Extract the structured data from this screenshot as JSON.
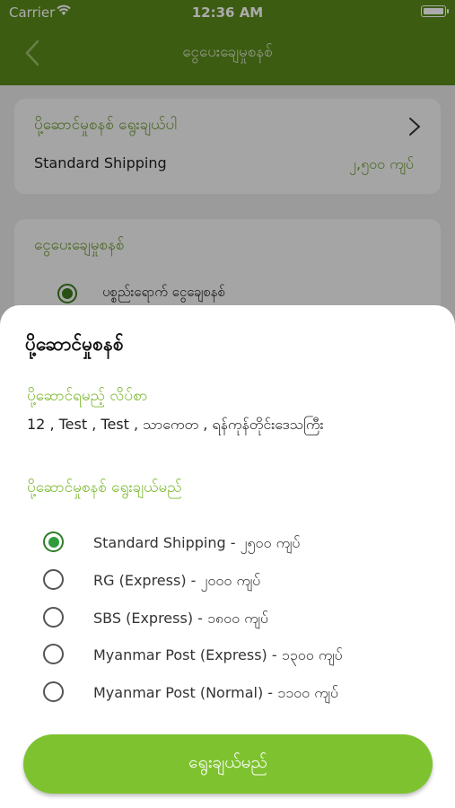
{
  "status_bar": {
    "carrier": "Carrier",
    "time": "12:36 AM"
  },
  "nav": {
    "title": "ငွေပေးချေမှုစနစ်"
  },
  "background": {
    "shipping_card": {
      "title": "ပို့ဆောင်မှုစနစ် ရွေးချယ်ပါ",
      "selected_name": "Standard Shipping",
      "selected_price": "၂,၅၀၀ ကျပ်"
    },
    "payment_card": {
      "title": "ငွေပေးချေမှုစနစ်",
      "option": "ပစ္စည်းရောက် ငွေချေစနစ်"
    }
  },
  "sheet": {
    "title": "ပို့ဆောင်မှုစနစ်",
    "address_label": "ပို့ဆောင်ရမည့် လိပ်စာ",
    "address_value": "12 , Test , Test , သာကေတ , ရန်ကုန်တိုင်းဒေသကြီး",
    "select_label": "ပို့ဆောင်မှုစနစ် ရွေးချယ်မည်",
    "options": [
      {
        "label": "Standard Shipping - ၂၅၀၀ ကျပ်",
        "selected": true
      },
      {
        "label": "RG (Express) - ၂၀၀၀ ကျပ်",
        "selected": false
      },
      {
        "label": "SBS (Express) - ၁၈၀၀ ကျပ်",
        "selected": false
      },
      {
        "label": "Myanmar Post (Express) - ၁၃၀၀ ကျပ်",
        "selected": false
      },
      {
        "label": "Myanmar Post (Normal) - ၁၁၀၀ ကျပ်",
        "selected": false
      }
    ],
    "button_label": "ရွေးချယ်မည်"
  },
  "colors": {
    "nav_bg": "#5a8a1c",
    "accent": "#7bb82d",
    "button": "#7ec32f"
  },
  "icons": [
    "wifi-icon",
    "battery-icon",
    "back-chevron-icon",
    "chevron-right-icon",
    "radio-selected-icon",
    "radio-unselected-icon"
  ]
}
